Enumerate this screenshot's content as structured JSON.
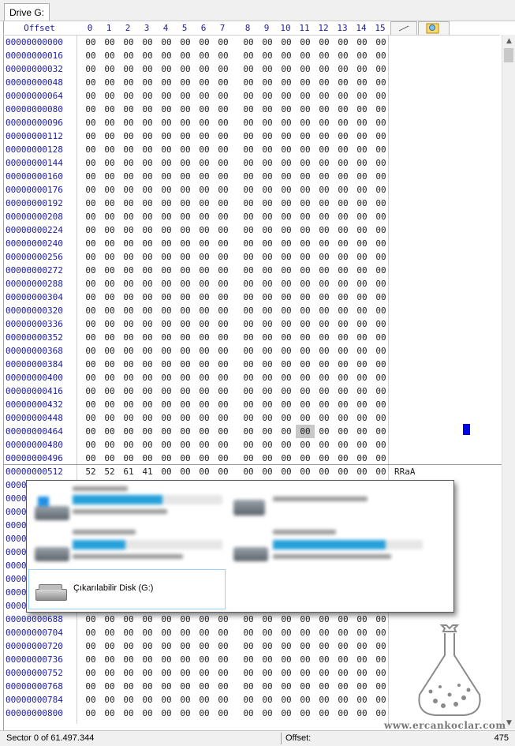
{
  "tab": {
    "label": "Drive G:"
  },
  "header": {
    "offset_label": "Offset",
    "columns": [
      "0",
      "1",
      "2",
      "3",
      "4",
      "5",
      "6",
      "7",
      "8",
      "9",
      "10",
      "11",
      "12",
      "13",
      "14",
      "15"
    ]
  },
  "offsets": [
    "00000000000",
    "00000000016",
    "00000000032",
    "00000000048",
    "00000000064",
    "00000000080",
    "00000000096",
    "00000000112",
    "00000000128",
    "00000000144",
    "00000000160",
    "00000000176",
    "00000000192",
    "00000000208",
    "00000000224",
    "00000000240",
    "00000000256",
    "00000000272",
    "00000000288",
    "00000000304",
    "00000000320",
    "00000000336",
    "00000000352",
    "00000000368",
    "00000000384",
    "00000000400",
    "00000000416",
    "00000000432",
    "00000000448",
    "00000000464",
    "00000000480",
    "00000000496",
    "00000000512",
    "00000000528",
    "00000000544",
    "00000000560",
    "00000000576",
    "00000000592",
    "00000000608",
    "00000000624",
    "00000000640",
    "00000000656",
    "00000000672",
    "00000000688",
    "00000000704",
    "00000000720",
    "00000000736",
    "00000000752",
    "00000000768",
    "00000000784",
    "00000000800"
  ],
  "row_512_bytes": [
    "52",
    "52",
    "61",
    "41",
    "00",
    "00",
    "00",
    "00",
    "00",
    "00",
    "00",
    "00",
    "00",
    "00",
    "00",
    "00"
  ],
  "default_byte": "00",
  "ascii_row_512": "RRaA",
  "highlight": {
    "row": "00000000464",
    "column": "11"
  },
  "status": {
    "sector": "Sector 0 of 61.497.344",
    "offset_label": "Offset:",
    "offset_value": "475"
  },
  "popup": {
    "selected_drive_label": "Çıkarılabilir Disk (G:)",
    "icons": [
      "windows-drive-icon",
      "optical-drive-icon",
      "hard-drive-icon",
      "hard-drive-icon",
      "usb-drive-icon"
    ],
    "usage_fractions": [
      0.6,
      0.35,
      0.75
    ]
  },
  "watermark": {
    "text": "www.ercankoclar.com"
  },
  "scrollbar": {
    "up": "▲",
    "down": "▼"
  },
  "colors": {
    "offset_text": "#1a1aa6",
    "selection": "#99d1ff",
    "cursor": "#0000e6",
    "bar_fill": "#26a0da"
  }
}
